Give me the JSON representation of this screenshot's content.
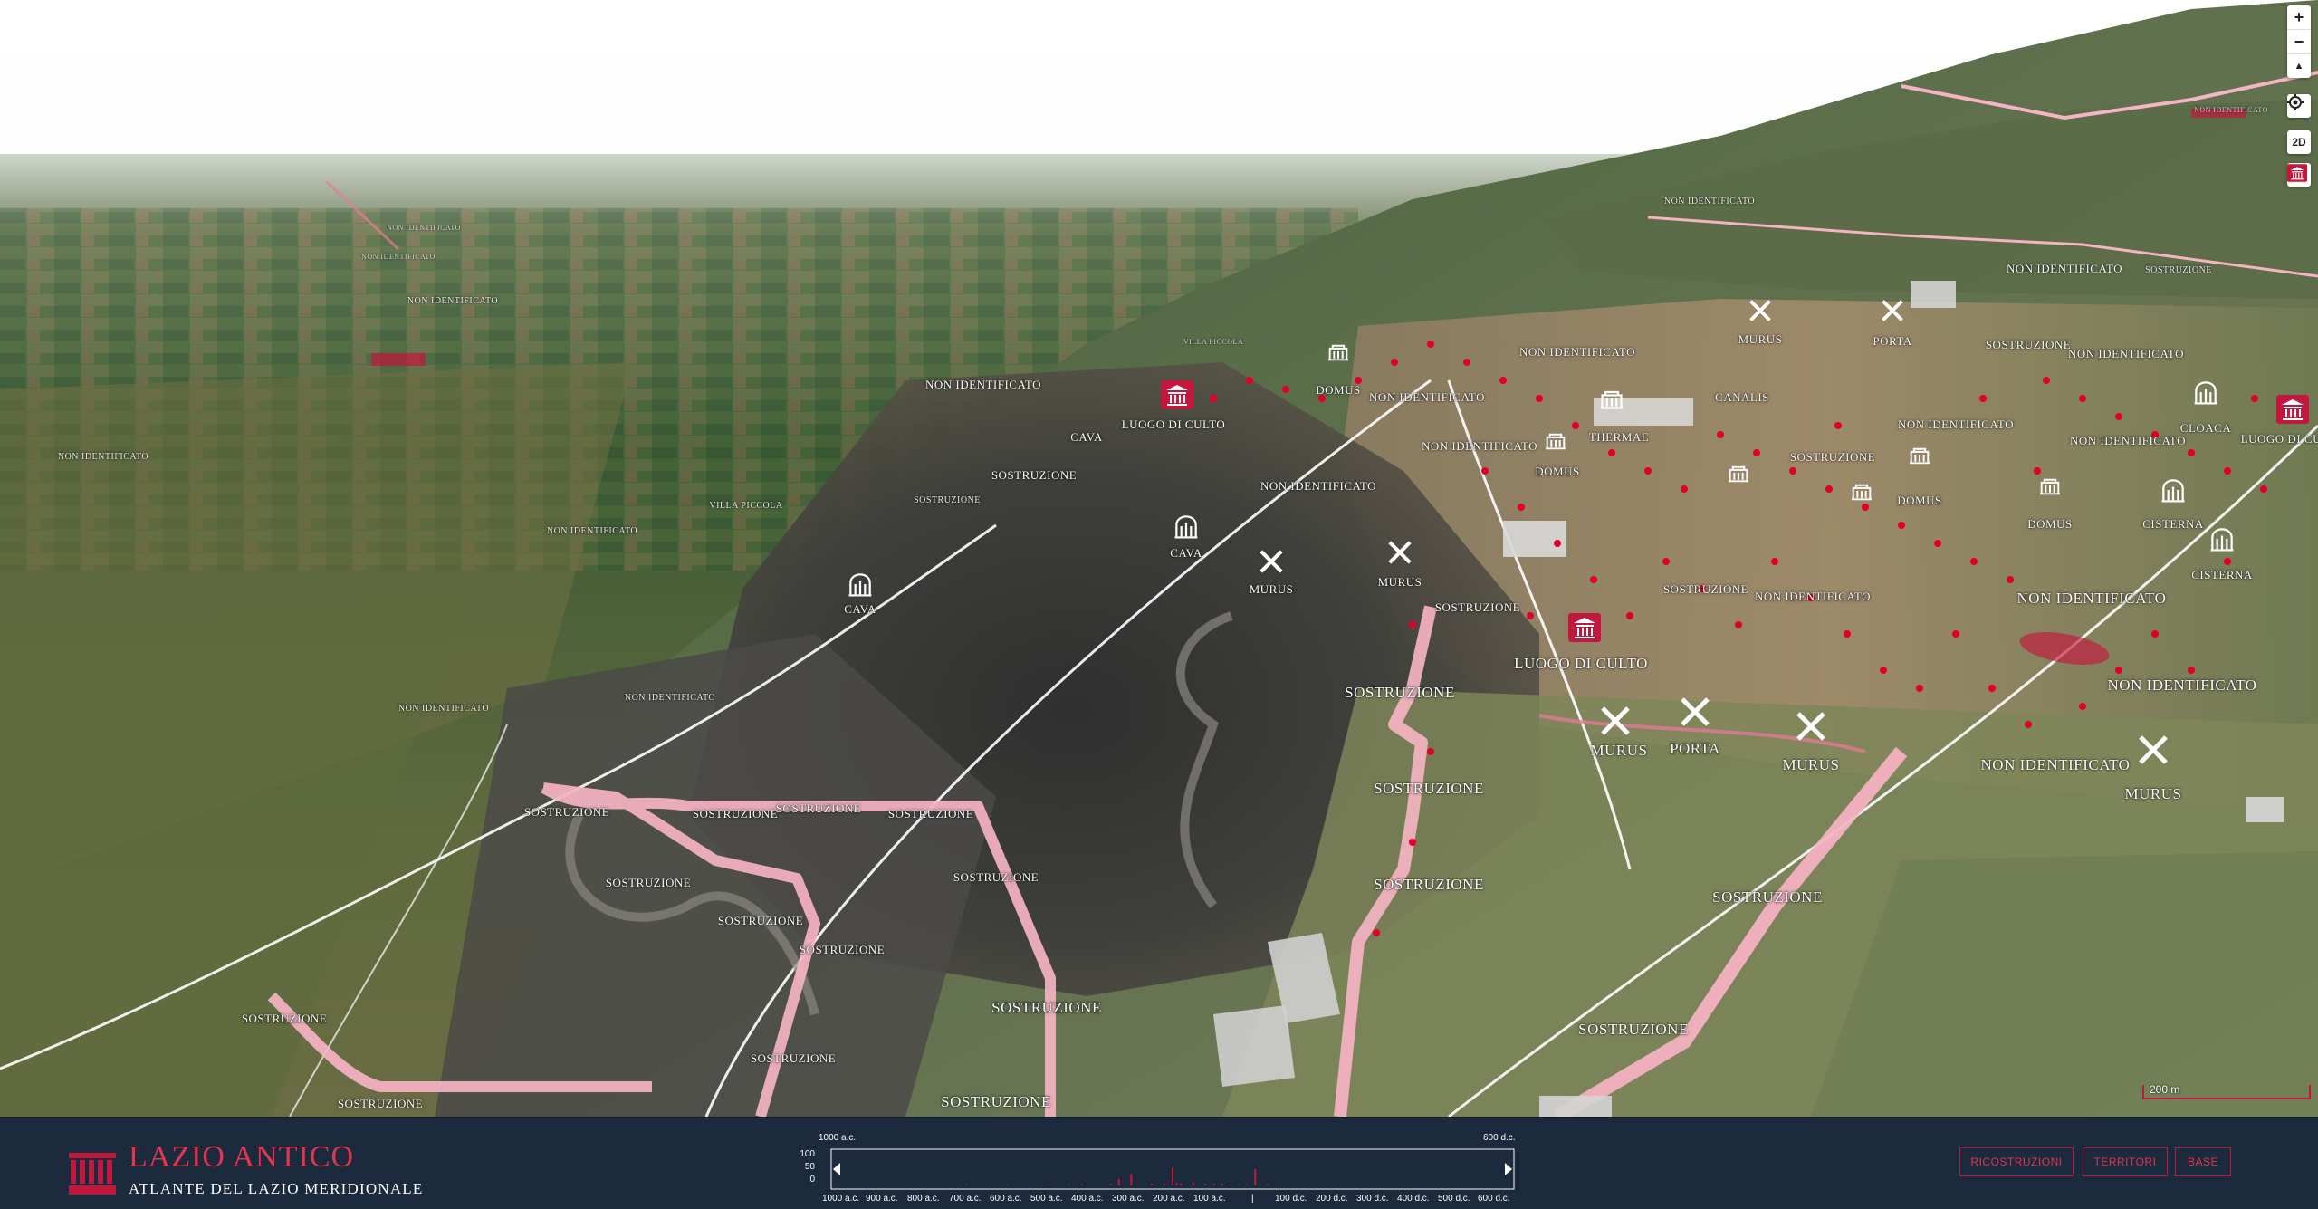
{
  "map": {
    "scale_label": "200 m",
    "controls": {
      "zoom_in": "+",
      "zoom_out": "−",
      "compass": "▲",
      "locate_icon": "locate-icon",
      "mode_2d": "2D",
      "layers_icon": "temple-layer-icon"
    },
    "colors": {
      "accent": "#c3183d",
      "route": "#f5b3c3",
      "sky": "#ffffff"
    },
    "labels_big": [
      "LUOGO DI CULTO",
      "SOSTRUZIONE",
      "SOSTRUZIONE",
      "SOSTRUZIONE",
      "SOSTRUZIONE",
      "SOSTRUZIONE",
      "SOSTRUZIONE",
      "MURUS",
      "PORTA",
      "MURUS",
      "MURUS",
      "SOSTRUZIONE",
      "NON IDENTIFICATO",
      "NON IDENTIFICATO",
      "NON IDENTIFICATO"
    ],
    "labels_med": [
      "LUOGO DI CULTO",
      "CAVA",
      "SOSTRUZIONE",
      "SOSTRUZIONE",
      "SOSTRUZIONE",
      "SOSTRUZIONE",
      "SOSTRUZIONE",
      "SOSTRUZIONE",
      "SOSTRUZIONE",
      "SOSTRUZIONE",
      "SOSTRUZIONE",
      "SOSTRUZIONE",
      "SOSTRUZIONE",
      "SOSTRUZIONE",
      "CAVA",
      "CAVA",
      "MURUS",
      "MURUS",
      "NON IDENTIFICATO",
      "THERMAE",
      "DOMUS",
      "DOMUS",
      "NON IDENTIFICATO",
      "NON IDENTIFICATO",
      "CANALIS",
      "CISTERNA",
      "CISTERNA",
      "CLOACA",
      "LUOGO DI CULTO",
      "NON IDENTIFICATO",
      "DOMUS",
      "NON IDENTIFICATO",
      "NON IDENTIFICATO",
      "NON IDENTIFICATO",
      "SOSTRUZIONE",
      "SOSTRUZIONE",
      "MURUS",
      "PORTA",
      "DOMUS",
      "NON IDENTIFICATO",
      "NON IDENTIFICATO",
      "SOSTRUZIONE",
      "SOSTRUZIONE",
      "NON IDENTIFICATO"
    ],
    "labels_sm": [
      "NON IDENTIFICATO",
      "NON IDENTIFICATO",
      "NON IDENTIFICATO",
      "NON IDENTIFICATO",
      "NON IDENTIFICATO",
      "SOSTRUZIONE",
      "VILLA PICCOLA",
      "NON IDENTIFICATO",
      "SOSTRUZIONE"
    ],
    "labels_xs": [
      "NON IDENTIFICATO",
      "VILLA PICCOLA",
      "NON IDENTIFICATO",
      "NON IDENTIFICATO"
    ]
  },
  "footer": {
    "brand_title": "LAZIO ANTICO",
    "brand_subtitle": "ATLANTE DEL LAZIO MERIDIONALE",
    "buttons": {
      "ricostruzioni": "RICOSTRUZIONI",
      "territori": "TERRITORI",
      "base": "BASE"
    }
  },
  "chart_data": {
    "type": "bar",
    "title": "",
    "range_start_label": "1000 a.c.",
    "range_end_label": "600 d.c.",
    "y_ticks": [
      "100",
      "50",
      "0"
    ],
    "ylim": [
      0,
      100
    ],
    "x_tick_labels": [
      "1000 a.c.",
      "900 a.c.",
      "800 a.c.",
      "700 a.c.",
      "600 a.c.",
      "500 a.c.",
      "400 a.c.",
      "300 a.c.",
      "200 a.c.",
      "100 a.c.",
      "|",
      "100 d.c.",
      "200 d.c.",
      "300 d.c.",
      "400 d.c.",
      "500 d.c.",
      "600 d.c."
    ],
    "x": [
      -700,
      -600,
      -500,
      -450,
      -420,
      -350,
      -330,
      -300,
      -250,
      -220,
      -200,
      -190,
      -180,
      -150,
      -120,
      -100,
      -80,
      -60,
      -40,
      -20,
      0,
      10,
      30
    ],
    "values": [
      2,
      2,
      3,
      2,
      3,
      4,
      20,
      35,
      5,
      6,
      55,
      8,
      6,
      10,
      5,
      4,
      6,
      3,
      2,
      2,
      50,
      2,
      3
    ],
    "colors": {
      "bar": "#c3183d",
      "axis": "#ffffff"
    }
  }
}
